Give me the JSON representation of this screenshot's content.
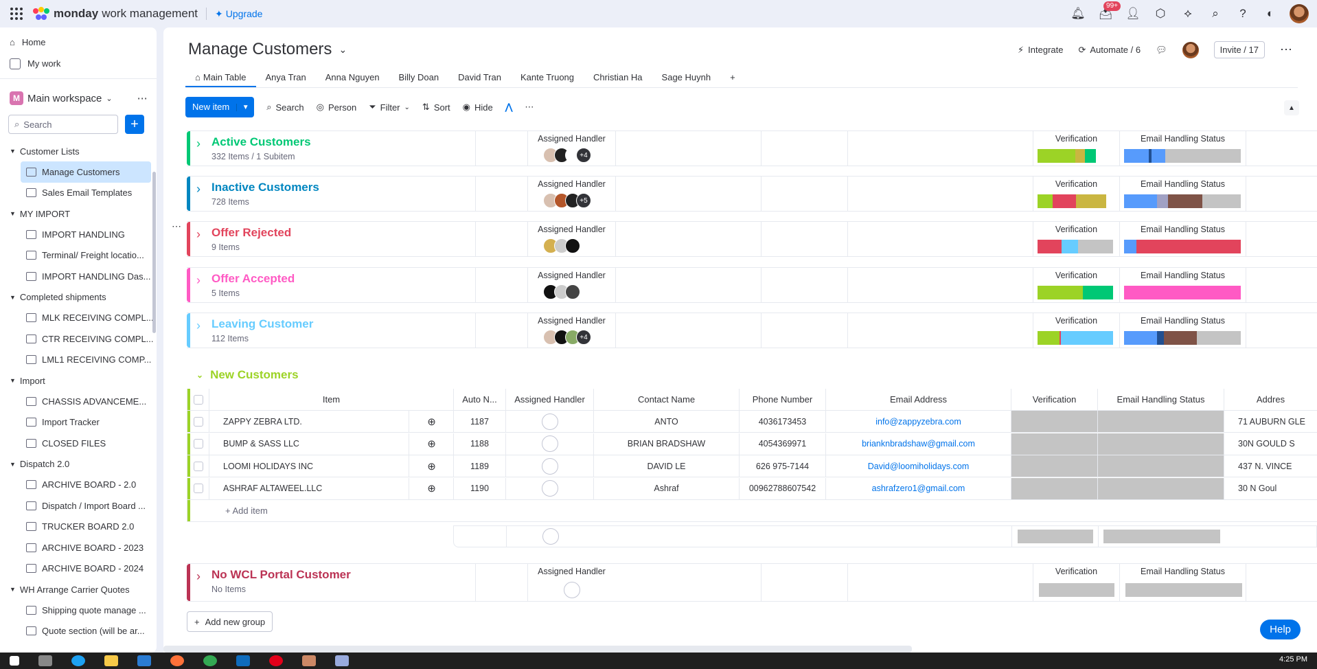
{
  "app": {
    "brand_bold": "monday",
    "brand_rest": "work management",
    "upgrade": "Upgrade",
    "notif_badge": "99+"
  },
  "sidebar": {
    "home": "Home",
    "mywork": "My work",
    "workspace_letter": "M",
    "workspace": "Main workspace",
    "search_placeholder": "Search",
    "folders": [
      {
        "name": "Customer Lists",
        "boards": [
          "Manage Customers",
          "Sales Email Templates"
        ]
      },
      {
        "name": "MY IMPORT",
        "boards": [
          "IMPORT HANDLING",
          "Terminal/ Freight locatio...",
          "IMPORT HANDLING Das..."
        ]
      },
      {
        "name": "Completed shipments",
        "boards": [
          "MLK RECEIVING COMPL...",
          "CTR RECEIVING COMPL...",
          "LML1 RECEIVING COMP..."
        ]
      },
      {
        "name": "Import",
        "boards": [
          "CHASSIS ADVANCEME...",
          "Import Tracker",
          "CLOSED FILES"
        ]
      },
      {
        "name": "Dispatch 2.0",
        "boards": [
          "ARCHIVE BOARD - 2.0",
          "Dispatch / Import Board ...",
          "TRUCKER BOARD 2.0",
          "ARCHIVE BOARD - 2023",
          "ARCHIVE BOARD - 2024"
        ]
      },
      {
        "name": "WH Arrange Carrier Quotes",
        "boards": [
          "Shipping quote manage ...",
          "Quote section (will be ar..."
        ]
      }
    ]
  },
  "header": {
    "title": "Manage Customers",
    "integrate": "Integrate",
    "automate": "Automate / 6",
    "invite": "Invite / 17",
    "tabs": [
      "Main Table",
      "Anya Tran",
      "Anna Nguyen",
      "Billy Doan",
      "David Tran",
      "Kante Truong",
      "Christian Ha",
      "Sage Huynh"
    ]
  },
  "toolbar": {
    "new_item": "New item",
    "search": "Search",
    "person": "Person",
    "filter": "Filter",
    "sort": "Sort",
    "hide": "Hide"
  },
  "col_labels": {
    "assigned": "Assigned Handler",
    "verification": "Verification",
    "email_status": "Email Handling Status"
  },
  "groups": [
    {
      "name": "Active Customers",
      "count": "332 Items / 1 Subitem",
      "color": "#00c875",
      "more": "+4"
    },
    {
      "name": "Inactive Customers",
      "count": "728 Items",
      "color": "#0086c0",
      "more": "+5"
    },
    {
      "name": "Offer Rejected",
      "count": "9 Items",
      "color": "#e2445c",
      "more": ""
    },
    {
      "name": "Offer Accepted",
      "count": "5 Items",
      "color": "#ff5ac4",
      "more": ""
    },
    {
      "name": "Leaving Customer",
      "count": "112 Items",
      "color": "#66ccff",
      "more": "+4"
    }
  ],
  "new_customers": {
    "title": "New Customers",
    "columns": [
      "Item",
      "Auto N...",
      "Assigned Handler",
      "Contact Name",
      "Phone Number",
      "Email Address",
      "Verification",
      "Email Handling Status",
      "Addres"
    ],
    "rows": [
      {
        "item": "ZAPPY ZEBRA LTD.",
        "auto": "1187",
        "contact": "ANTO",
        "phone": "4036173453",
        "email": "info@zappyzebra.com",
        "address": "71 AUBURN GLE"
      },
      {
        "item": "BUMP & SASS LLC",
        "auto": "1188",
        "contact": "BRIAN BRADSHAW",
        "phone": "4054369971",
        "email": "brianknbradshaw@gmail.com",
        "address": "30N GOULD S"
      },
      {
        "item": "LOOMI HOLIDAYS INC",
        "auto": "1189",
        "contact": "DAVID LE",
        "phone": "626 975-7144",
        "email": "David@loomiholidays.com",
        "address": "437 N. VINCE"
      },
      {
        "item": "ASHRAF ALTAWEEL.LLC",
        "auto": "1190",
        "contact": "Ashraf",
        "phone": "00962788607542",
        "email": "ashrafzero1@gmail.com",
        "address": "30 N Goul"
      }
    ],
    "add_item": "+ Add item"
  },
  "no_wcl": {
    "name": "No WCL Portal Customer",
    "count": "No Items"
  },
  "add_group": "Add new group",
  "help": "Help",
  "clock": "4:25 PM"
}
